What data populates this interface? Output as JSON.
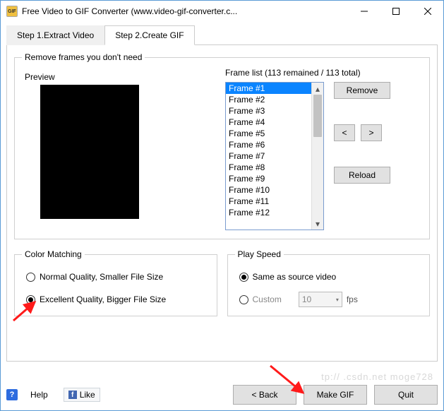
{
  "window": {
    "title": "Free Video to GIF Converter (www.video-gif-converter.c...",
    "app_icon_text": "GIF"
  },
  "tabs": {
    "step1": "Step 1.Extract Video",
    "step2": "Step 2.Create GIF"
  },
  "frames": {
    "legend": "Remove frames you don't need",
    "preview_label": "Preview",
    "list_title": "Frame list (113 remained / 113 total)",
    "items": [
      "Frame #1",
      "Frame #2",
      "Frame #3",
      "Frame #4",
      "Frame #5",
      "Frame #6",
      "Frame #7",
      "Frame #8",
      "Frame #9",
      "Frame #10",
      "Frame #11",
      "Frame #12"
    ],
    "remove_btn": "Remove",
    "prev_btn": "<",
    "next_btn": ">",
    "reload_btn": "Reload"
  },
  "color": {
    "legend": "Color Matching",
    "opt_normal": "Normal Quality, Smaller File Size",
    "opt_excellent": "Excellent Quality, Bigger File Size"
  },
  "speed": {
    "legend": "Play Speed",
    "opt_same": "Same as source video",
    "opt_custom": "Custom",
    "custom_value": "10",
    "fps_label": "fps"
  },
  "bottom": {
    "help": "Help",
    "like": "Like",
    "back": "< Back",
    "make": "Make GIF",
    "quit": "Quit"
  },
  "watermark": "tp:// .csdn.net moge728"
}
